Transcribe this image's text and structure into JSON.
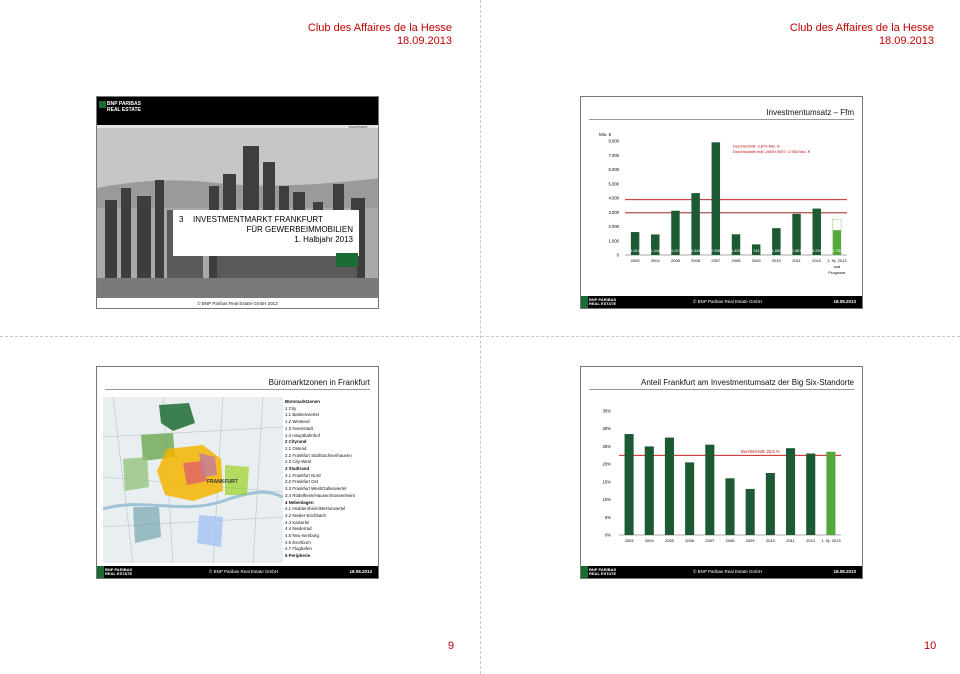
{
  "page": {
    "header_title": "Club des Affaires de la Hesse",
    "header_date": "18.09.2013",
    "page_left": "9",
    "page_right": "10"
  },
  "common": {
    "logo_line1": "BNP PARIBAS",
    "logo_line2": "REAL ESTATE",
    "copyright": "© BNP Paribas Real Estate GmbH",
    "date": "18.08.2013"
  },
  "slide1": {
    "tag": "INVESTMENT",
    "number": "3",
    "title_line1": "INVESTMENTMARKT FRANKFURT",
    "title_line2": "FÜR GEWERBEIMMOBILIEN",
    "title_line3": "1. Halbjahr 2013",
    "copyright": "© BNP Paribas Real Estate GmbH 2013"
  },
  "slide2": {
    "title": "Investmentumsatz – Ffm",
    "unit": "Mio. €",
    "avg_line1": "Durchschnitt: 3.879 Mio. €",
    "avg_line2": "Durchschnitt exkl. 2006+2007: 2.963 Mio. €",
    "last_label_line2": "und",
    "last_label_line3": "Prognose"
  },
  "slide3": {
    "title": "Büromarktzonen in Frankfurt",
    "map_label": "FRANKFURT",
    "legend": [
      {
        "text": "Büromarktzonen",
        "bold": true
      },
      {
        "text": "1 City",
        "bold": false
      },
      {
        "text": "1.1 Bankenviertel",
        "bold": false
      },
      {
        "text": "1.2 Westend",
        "bold": false
      },
      {
        "text": "1.3 Innenstadt",
        "bold": false
      },
      {
        "text": "1.4 Hauptbahnhof",
        "bold": false
      },
      {
        "text": "2 Cityrand",
        "bold": true
      },
      {
        "text": "2.1 Ostend",
        "bold": false
      },
      {
        "text": "2.2 Frankfurt Süd/Sachsenhausen",
        "bold": false
      },
      {
        "text": "2.3 City-West",
        "bold": false
      },
      {
        "text": "3 Stadtrand",
        "bold": true
      },
      {
        "text": "3.1 Frankfurt Nord",
        "bold": false
      },
      {
        "text": "3.2 Frankfurt Ost",
        "bold": false
      },
      {
        "text": "3.3 Frankfurt West/Gallusviertel",
        "bold": false
      },
      {
        "text": "3.4 Rödelheim/Hausen/Sossenheim",
        "bold": false
      },
      {
        "text": "4 Nebenlagen",
        "bold": true
      },
      {
        "text": "4.1 Heddernheim/Mertonviertel",
        "bold": false
      },
      {
        "text": "4.2 Nieder-Eschbach",
        "bold": false
      },
      {
        "text": "4.3 Kaiserlei",
        "bold": false
      },
      {
        "text": "4.4 Niederrad",
        "bold": false
      },
      {
        "text": "4.5 Neu-Isenburg",
        "bold": false
      },
      {
        "text": "4.6 Eschborn",
        "bold": false
      },
      {
        "text": "4.7 Flughafen",
        "bold": false
      },
      {
        "text": "5 Peripherie",
        "bold": true
      }
    ]
  },
  "slide4": {
    "title": "Anteil Frankfurt am Investmentumsatz der Big Six-Standorte",
    "avg_label": "Durchschnitt: 22,5 %"
  },
  "chart_data": [
    {
      "type": "bar",
      "title": "Investmentumsatz – Ffm",
      "ylabel": "Mio. €",
      "categories": [
        "2003",
        "2004",
        "2005",
        "2006",
        "2007",
        "2008",
        "2009",
        "2010",
        "2011",
        "2012",
        "1. Hj. 2013"
      ],
      "values": [
        1610,
        1444,
        3107,
        4344,
        7908,
        1453,
        744,
        1883,
        2887,
        3259,
        1730
      ],
      "value_labels": [
        "1.610",
        "1.444",
        "3.107",
        "4.344",
        "7.908",
        "1.453",
        "744",
        "1.883",
        "2.887",
        "3.259",
        "1.730"
      ],
      "forecast_total": 2500,
      "yticks": [
        "0",
        "1.000",
        "2.000",
        "3.000",
        "4.000",
        "5.000",
        "6.000",
        "7.000",
        "8.000"
      ],
      "ylim": [
        0,
        8000
      ],
      "averages": [
        3879,
        2963
      ],
      "colors": {
        "bar": "#1d5a34",
        "last": "#55a83b",
        "forecast": "#8fc46a",
        "avg1": "#c00000",
        "avg2": "#8b0000"
      }
    },
    {
      "type": "bar",
      "title": "Anteil Frankfurt am Investmentumsatz der Big Six-Standorte",
      "categories": [
        "2003",
        "2004",
        "2005",
        "2006",
        "2007",
        "2008",
        "2009",
        "2010",
        "2011",
        "2012",
        "1. Hj. 2013"
      ],
      "values": [
        28.5,
        25,
        27.5,
        20.5,
        25.5,
        16,
        13,
        17.5,
        24.5,
        23,
        23.5
      ],
      "yticks": [
        "0%",
        "5%",
        "10%",
        "15%",
        "20%",
        "25%",
        "30%",
        "35%"
      ],
      "ylim": [
        0,
        35
      ],
      "average": 22.5,
      "colors": {
        "bar": "#1d5a34",
        "last": "#55a83b",
        "avg": "#c00000"
      }
    }
  ]
}
